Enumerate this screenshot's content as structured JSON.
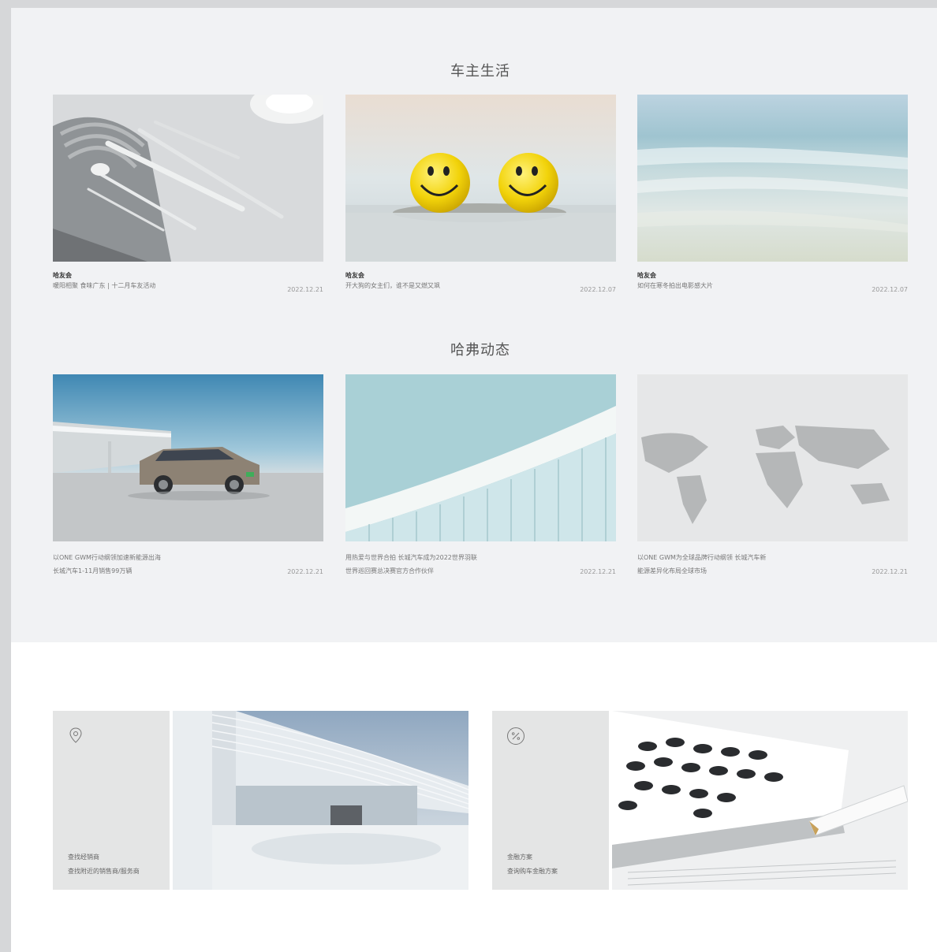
{
  "owner_life": {
    "title": "车主生活",
    "cards": [
      {
        "category": "哈友会",
        "desc": "暖阳相聚 食味广东 | 十二月车友活动",
        "date": "2022.12.21"
      },
      {
        "category": "哈友会",
        "desc": "开大狗的女主们，谁不是又燃又飒",
        "date": "2022.12.07"
      },
      {
        "category": "哈友会",
        "desc": "如何在寒冬拍出电影感大片",
        "date": "2022.12.07"
      }
    ]
  },
  "haval_news": {
    "title": "哈弗动态",
    "cards": [
      {
        "line1": "以ONE GWM行动纲领加速新能源出海",
        "line2": "长城汽车1-11月销售99万辆",
        "date": "2022.12.21"
      },
      {
        "line1": "用热爱与世界合拍 长城汽车成为2022世界羽联",
        "line2": "世界巡回赛总决赛官方合作伙伴",
        "date": "2022.12.21"
      },
      {
        "line1": "以ONE GWM为全球品牌行动纲领 长城汽车新",
        "line2": "能源差异化布局全球市场",
        "date": "2022.12.21"
      }
    ]
  },
  "promos": [
    {
      "icon": "location-pin-icon",
      "title": "查找经销商",
      "subtitle": "查找附近的销售商/服务商"
    },
    {
      "icon": "percent-circle-icon",
      "title": "金融方案",
      "subtitle": "查询购车金融方案"
    }
  ]
}
